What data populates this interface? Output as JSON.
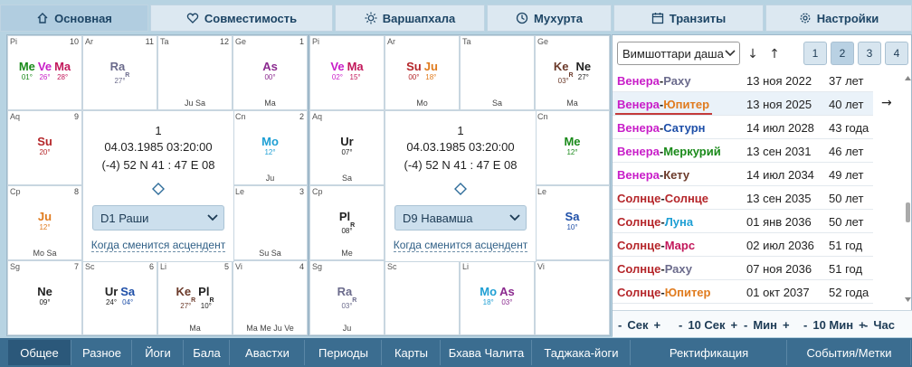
{
  "top_tabs": [
    "Основная",
    "Совместимость",
    "Варшапхала",
    "Мухурта",
    "Транзиты",
    "Настройки"
  ],
  "colors": {
    "Su": "#b5262a",
    "Mo": "#1e9fd4",
    "Ma": "#c2185b",
    "Me": "#1a8a1a",
    "Ju": "#e07b1e",
    "Ve": "#c81dc8",
    "Sa": "#1e4fa8",
    "Ra": "#6b6b8c",
    "Ke": "#6b3a2a",
    "As": "#8b2a8f",
    "Ur": "#222222",
    "Ne": "#222222",
    "Pl": "#222222"
  },
  "charts": [
    {
      "houses": [
        {
          "sign": "Pi",
          "num": "10",
          "planets": [
            {
              "n": "Me",
              "c": "Me",
              "d": "01°"
            },
            {
              "n": "Ve",
              "c": "Ve",
              "d": "26°"
            },
            {
              "n": "Ma",
              "c": "Ma",
              "d": "28°"
            }
          ],
          "aspects": ""
        },
        {
          "sign": "Ar",
          "num": "11",
          "planets": [
            {
              "n": "Ra",
              "c": "Ra",
              "r": "R",
              "d": "27°"
            }
          ],
          "aspects": ""
        },
        {
          "sign": "Ta",
          "num": "12",
          "planets": [],
          "aspects": "Ju Sa"
        },
        {
          "sign": "Ge",
          "num": "1",
          "planets": [
            {
              "n": "As",
              "c": "As",
              "d": "00°"
            }
          ],
          "aspects": "Ma"
        },
        {
          "sign": "Aq",
          "num": "9",
          "planets": [
            {
              "n": "Su",
              "c": "Su",
              "d": "20°"
            }
          ],
          "aspects": ""
        },
        {
          "sign": "Cn",
          "num": "2",
          "planets": [
            {
              "n": "Mo",
              "c": "Mo",
              "d": "12°"
            }
          ],
          "aspects": "Ju"
        },
        {
          "sign": "Cp",
          "num": "8",
          "planets": [
            {
              "n": "Ju",
              "c": "Ju",
              "d": "12°"
            }
          ],
          "aspects": "Mo Sa"
        },
        {
          "sign": "Le",
          "num": "3",
          "planets": [],
          "aspects": "Su Sa"
        },
        {
          "sign": "Sg",
          "num": "7",
          "planets": [
            {
              "n": "Ne",
              "c": "Ne",
              "d": "09°"
            }
          ],
          "aspects": ""
        },
        {
          "sign": "Sc",
          "num": "6",
          "planets": [
            {
              "n": "Ur",
              "c": "Ur",
              "d": "24°"
            },
            {
              "n": "Sa",
              "c": "Sa",
              "d": "04°"
            }
          ],
          "aspects": ""
        },
        {
          "sign": "Li",
          "num": "5",
          "planets": [
            {
              "n": "Ke",
              "c": "Ke",
              "r": "R",
              "d": "27°"
            },
            {
              "n": "Pl",
              "c": "Pl",
              "r": "R",
              "d": "10°"
            }
          ],
          "aspects": "Ma"
        },
        {
          "sign": "Vi",
          "num": "4",
          "planets": [],
          "aspects": "Ma Me Ju Ve"
        }
      ],
      "center": {
        "num": "1",
        "date": "04.03.1985 03:20:00",
        "coords": "(-4) 52 N 41 : 47 E 08",
        "select": "D1 Раши",
        "link": "Когда сменится асцендент"
      }
    },
    {
      "houses": [
        {
          "sign": "Pi",
          "num": "",
          "planets": [
            {
              "n": "Ve",
              "c": "Ve",
              "d": "02°"
            },
            {
              "n": "Ma",
              "c": "Ma",
              "d": "15°"
            }
          ],
          "aspects": ""
        },
        {
          "sign": "Ar",
          "num": "",
          "planets": [
            {
              "n": "Su",
              "c": "Su",
              "d": "00°"
            },
            {
              "n": "Ju",
              "c": "Ju",
              "d": "18°"
            }
          ],
          "aspects": "Mo"
        },
        {
          "sign": "Ta",
          "num": "",
          "planets": [],
          "aspects": "Sa"
        },
        {
          "sign": "Ge",
          "num": "",
          "planets": [
            {
              "n": "Ke",
              "c": "Ke",
              "r": "R",
              "d": "03°"
            },
            {
              "n": "Ne",
              "c": "Ne",
              "d": "27°"
            }
          ],
          "aspects": "Ma"
        },
        {
          "sign": "Aq",
          "num": "",
          "planets": [
            {
              "n": "Ur",
              "c": "Ur",
              "d": "07°"
            }
          ],
          "aspects": "Sa"
        },
        {
          "sign": "Cn",
          "num": "",
          "planets": [
            {
              "n": "Me",
              "c": "Me",
              "d": "12°"
            }
          ],
          "aspects": ""
        },
        {
          "sign": "Cp",
          "num": "",
          "planets": [
            {
              "n": "Pl",
              "c": "Pl",
              "r": "R",
              "d": "08°"
            }
          ],
          "aspects": "Me"
        },
        {
          "sign": "Le",
          "num": "",
          "planets": [
            {
              "n": "Sa",
              "c": "Sa",
              "d": "10°"
            }
          ],
          "aspects": ""
        },
        {
          "sign": "Sg",
          "num": "",
          "planets": [
            {
              "n": "Ra",
              "c": "Ra",
              "r": "R",
              "d": "03°"
            }
          ],
          "aspects": "Ju"
        },
        {
          "sign": "Sc",
          "num": "",
          "planets": [],
          "aspects": ""
        },
        {
          "sign": "Li",
          "num": "",
          "planets": [
            {
              "n": "Mo",
              "c": "Mo",
              "d": "18°"
            },
            {
              "n": "As",
              "c": "As",
              "d": "03°"
            }
          ],
          "aspects": ""
        },
        {
          "sign": "Vi",
          "num": "",
          "planets": [],
          "aspects": ""
        }
      ],
      "center": {
        "num": "1",
        "date": "04.03.1985 03:20:00",
        "coords": "(-4) 52 N 41 : 47 E 08",
        "select": "D9 Навамша",
        "link": "Когда сменится асцендент"
      }
    }
  ],
  "dasha": {
    "select": "Вимшоттари даша",
    "levels": [
      "1",
      "2",
      "3",
      "4"
    ],
    "active_level": 1,
    "rows": [
      {
        "p1": "Венера",
        "c1": "Ve",
        "p2": "Раху",
        "c2": "Ra",
        "date": "13 ноя 2022",
        "age": "37 лет",
        "clip": true
      },
      {
        "p1": "Венера",
        "c1": "Ve",
        "p2": "Юпитер",
        "c2": "Ju",
        "date": "13 ноя 2025",
        "age": "40 лет",
        "current": true
      },
      {
        "p1": "Венера",
        "c1": "Ve",
        "p2": "Сатурн",
        "c2": "Sa",
        "date": "14 июл 2028",
        "age": "43 года"
      },
      {
        "p1": "Венера",
        "c1": "Ve",
        "p2": "Меркурий",
        "c2": "Me",
        "date": "13 сен 2031",
        "age": "46 лет"
      },
      {
        "p1": "Венера",
        "c1": "Ve",
        "p2": "Кету",
        "c2": "Ke",
        "date": "14 июл 2034",
        "age": "49 лет"
      },
      {
        "p1": "Солнце",
        "c1": "Su",
        "p2": "Солнце",
        "c2": "Su",
        "date": "13 сен 2035",
        "age": "50 лет"
      },
      {
        "p1": "Солнце",
        "c1": "Su",
        "p2": "Луна",
        "c2": "Mo",
        "date": "01 янв 2036",
        "age": "50 лет"
      },
      {
        "p1": "Солнце",
        "c1": "Su",
        "p2": "Марс",
        "c2": "Ma",
        "date": "02 июл 2036",
        "age": "51 год"
      },
      {
        "p1": "Солнце",
        "c1": "Su",
        "p2": "Раху",
        "c2": "Ra",
        "date": "07 ноя 2036",
        "age": "51 год"
      },
      {
        "p1": "Солнце",
        "c1": "Su",
        "p2": "Юпитер",
        "c2": "Ju",
        "date": "01 окт 2037",
        "age": "52 года"
      }
    ],
    "time_controls": [
      {
        "label": "Сек"
      },
      {
        "label": "10 Сек"
      },
      {
        "label": "Мин"
      },
      {
        "label": "10 Мин"
      },
      {
        "label": "Час"
      }
    ]
  },
  "bottom_tabs": [
    "Общее",
    "Разное",
    "Йоги",
    "Бала",
    "Авастхи",
    "Периоды",
    "Карты",
    "Бхава Чалита",
    "Таджака-йоги",
    "Ректификация",
    "События/Метки"
  ]
}
